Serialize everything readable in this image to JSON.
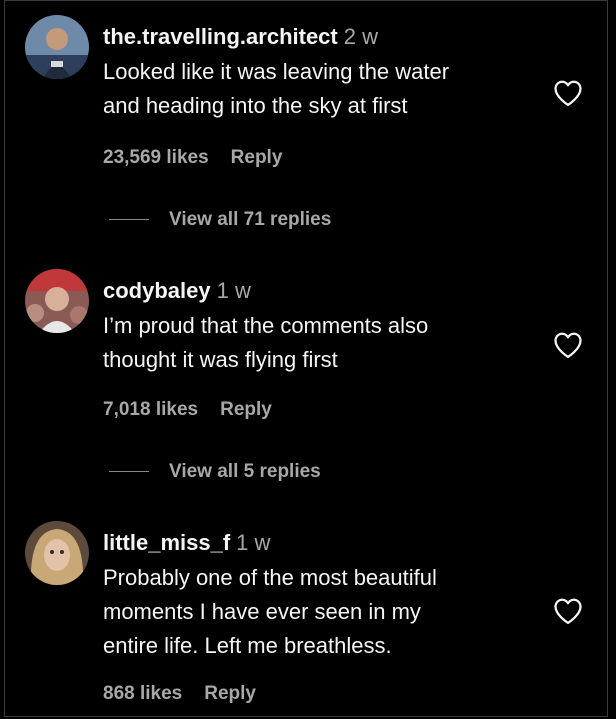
{
  "comments": [
    {
      "username": "the.travelling.architect",
      "time": "2 w",
      "text_lines": [
        "Looked like it was leaving the water",
        "and heading into the sky at first"
      ],
      "likes": "23,569 likes",
      "reply_label": "Reply",
      "view_replies": "View all 71 replies"
    },
    {
      "username": "codybaley",
      "time": "1 w",
      "text_lines": [
        "I’m proud that the comments also",
        "thought it was flying first"
      ],
      "likes": "7,018 likes",
      "reply_label": "Reply",
      "view_replies": "View all 5 replies"
    },
    {
      "username": "little_miss_f",
      "time": "1 w",
      "text_lines": [
        "Probably one of the most beautiful",
        "moments I have ever seen in my",
        "entire life. Left me breathless."
      ],
      "likes": "868 likes",
      "reply_label": "Reply"
    }
  ],
  "icons": {
    "like": "heart-outline-icon"
  },
  "colors": {
    "background": "#000000",
    "primary_text": "#f5f5f5",
    "secondary_text": "#a8a8a8"
  }
}
